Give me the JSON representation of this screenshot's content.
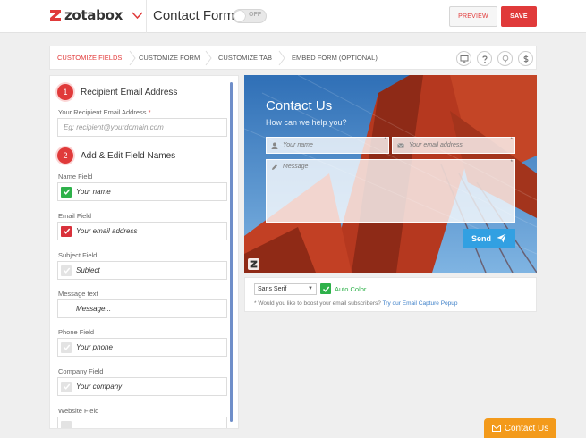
{
  "header": {
    "brand": "zotabox",
    "title": "Contact Form",
    "toggle_label": "OFF",
    "preview_label": "PREVIEW",
    "save_label": "SAVE"
  },
  "steps": [
    "CUSTOMIZE FIELDS",
    "CUSTOMIZE FORM",
    "CUSTOMIZE TAB",
    "EMBED FORM (OPTIONAL)"
  ],
  "nav_icons": [
    "desktop-icon",
    "help-icon",
    "lightbulb-icon",
    "dollar-icon"
  ],
  "left": {
    "sec1_num": "1",
    "sec1_title": "Recipient Email Address",
    "recipient_label": "Your Recipient Email Address",
    "required_mark": "*",
    "recipient_placeholder": "Eg: recipient@yourdomain.com",
    "sec2_num": "2",
    "sec2_title": "Add & Edit Field Names",
    "fields": [
      {
        "label": "Name Field",
        "value": "Your name",
        "state": "green"
      },
      {
        "label": "Email Field",
        "value": "Your email address",
        "state": "red"
      },
      {
        "label": "Subject Field",
        "value": "Subject",
        "state": "off"
      },
      {
        "label": "Message text",
        "value": "Message...",
        "state": "none"
      },
      {
        "label": "Phone Field",
        "value": "Your phone",
        "state": "off"
      },
      {
        "label": "Company Field",
        "value": "Your company",
        "state": "off"
      },
      {
        "label": "Website Field",
        "value": "",
        "state": "off"
      }
    ]
  },
  "preview": {
    "title": "Contact Us",
    "subtitle": "How can we help you?",
    "name_placeholder": "Your name",
    "email_placeholder": "Your email address",
    "message_placeholder": "Message",
    "required_mark": "*",
    "send_label": "Send"
  },
  "options": {
    "font_value": "Sans Serif",
    "auto_color_label": "Auto Color",
    "note_text": "* Would you like to boost your email subscribers?",
    "note_link": "Try our Email Capture Popup"
  },
  "contact_tab": "Contact Us",
  "colors": {
    "accent_red": "#e03a3a",
    "green": "#2eb14a",
    "send_blue": "#32a0e2",
    "tab_orange": "#f39a1b"
  }
}
